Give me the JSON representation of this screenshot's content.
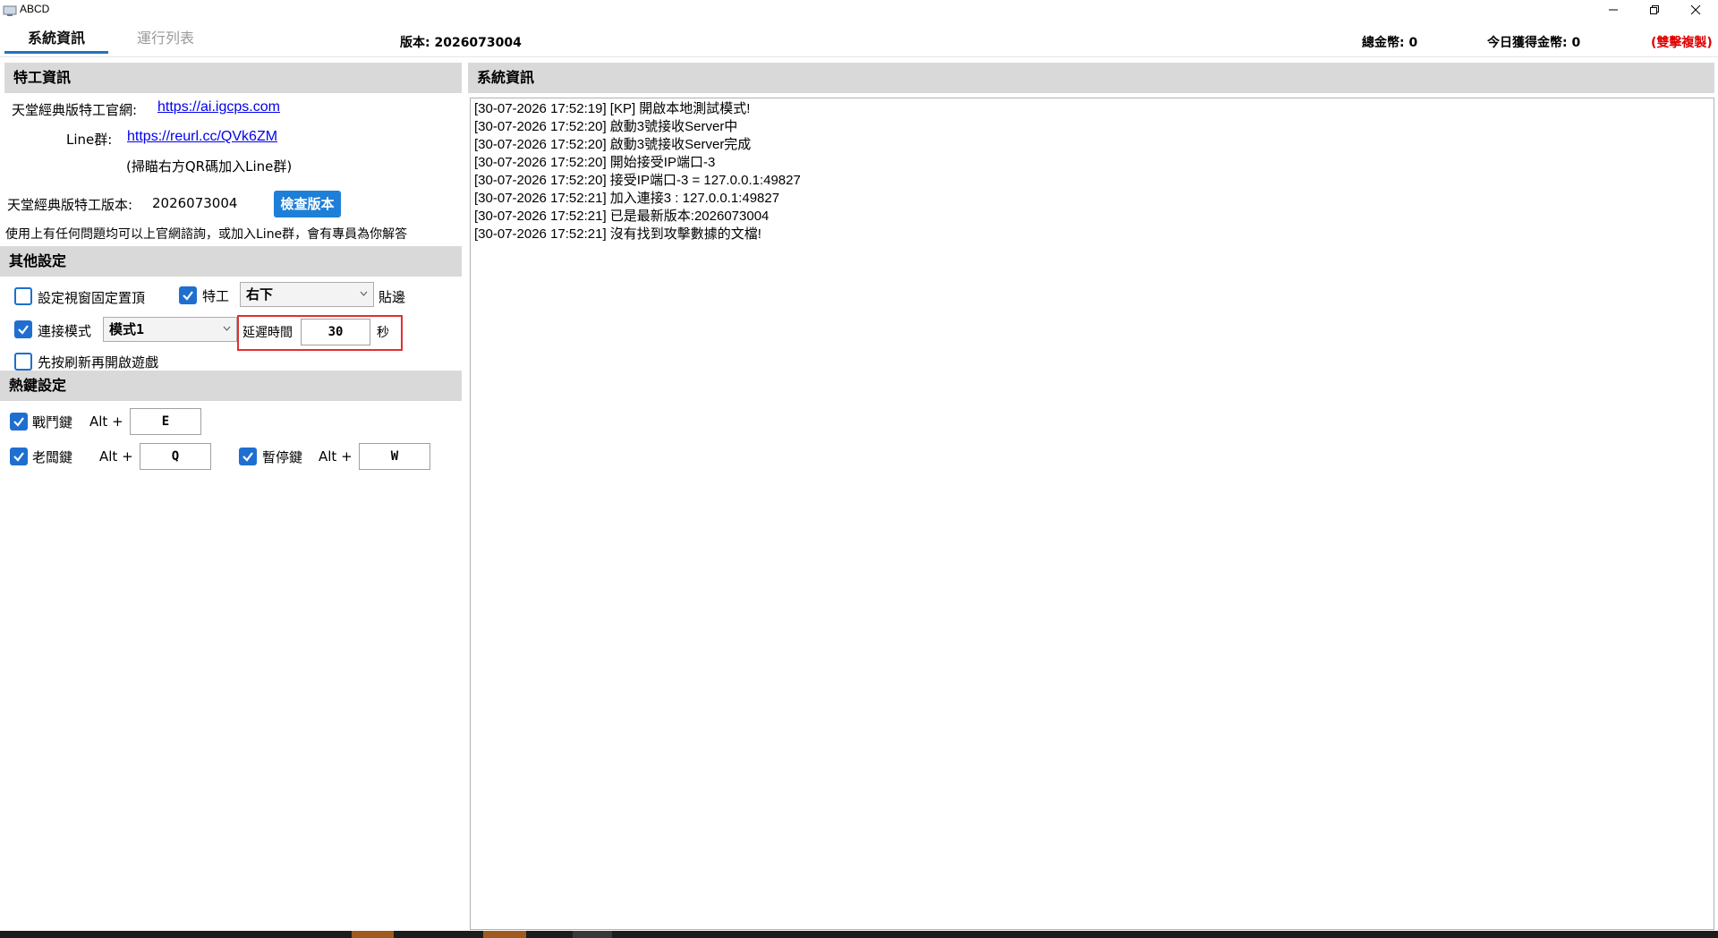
{
  "window": {
    "title": "ABCD"
  },
  "header": {
    "tabs": [
      {
        "label": "系統資訊",
        "active": true
      },
      {
        "label": "運行列表",
        "active": false
      }
    ],
    "version": "版本: 2026073004",
    "total_coins": "總金幣:  0",
    "today_coins": "今日獲得金幣:  0",
    "mode_label": "(雙擊複製)",
    "mode_color": "#e00000"
  },
  "agent_info": {
    "section_title": "特工資訊",
    "site_label": "天堂經典版特工官網:",
    "site_url": "https://ai.igcps.com",
    "line_label": "Line群:",
    "line_url": "https://reurl.cc/QVk6ZM",
    "qr_hint": "(掃瞄右方QR碼加入Line群)",
    "version_label": "天堂經典版特工版本:",
    "version_value": "2026073004",
    "check_button": "檢查版本",
    "help_text": "使用上有任何問題均可以上官網諮詢，或加入Line群，會有專員為你解答"
  },
  "other_settings": {
    "section_title": "其他設定",
    "pin_top": {
      "label": "設定視窗固定置頂",
      "checked": false
    },
    "agent": {
      "label": "特工",
      "checked": true
    },
    "position_select": "右下",
    "snap_label": "貼邊",
    "connect_mode": {
      "label": "連接模式",
      "checked": true
    },
    "mode_select": "模式1",
    "delay_label": "延遲時間",
    "delay_value": "30",
    "delay_unit": "秒",
    "refresh_first": {
      "label": "先按刷新再開啟遊戲",
      "checked": false
    }
  },
  "hotkeys": {
    "section_title": "熱鍵設定",
    "battle": {
      "label": "戰鬥鍵",
      "checked": true,
      "prefix": "Alt +",
      "key": "E"
    },
    "boss": {
      "label": "老闆鍵",
      "checked": true,
      "prefix": "Alt +",
      "key": "Q"
    },
    "pause": {
      "label": "暫停鍵",
      "checked": true,
      "prefix": "Alt +",
      "key": "W"
    }
  },
  "system_info": {
    "section_title": "系統資訊",
    "log": [
      "[30-07-2026 17:52:19] [KP] 開啟本地測試模式!",
      "[30-07-2026 17:52:20] 啟動3號接收Server中",
      "[30-07-2026 17:52:20] 啟動3號接收Server完成",
      "[30-07-2026 17:52:20] 開始接受IP端口-3",
      "[30-07-2026 17:52:20] 接受IP端口-3 =  127.0.0.1:49827",
      "[30-07-2026 17:52:21] 加入連接3 :  127.0.0.1:49827",
      "[30-07-2026 17:52:21] 已是最新版本:2026073004",
      "[30-07-2026 17:52:21] 沒有找到攻擊數據的文檔!"
    ]
  },
  "colors": {
    "accent": "#1f6fd0",
    "section_bg": "#d9d9d9",
    "highlight": "#e03030"
  }
}
